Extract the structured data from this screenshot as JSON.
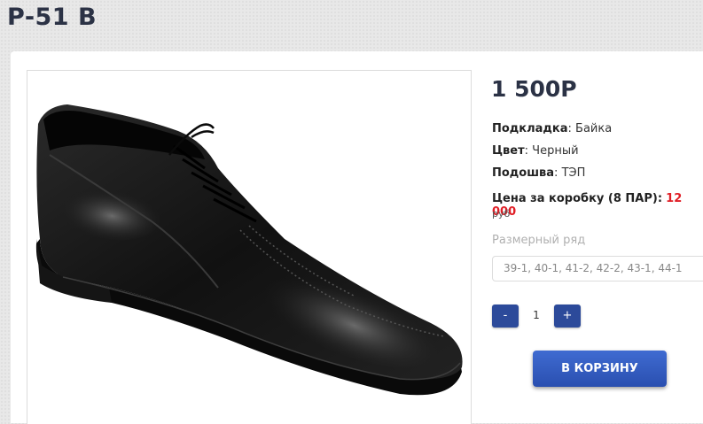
{
  "product": {
    "title": "P-51 B",
    "price": "1 500Р",
    "attributes": [
      {
        "label": "Подкладка",
        "value": "Байка"
      },
      {
        "label": "Цвет",
        "value": "Черный"
      },
      {
        "label": "Подошва",
        "value": "ТЭП"
      }
    ],
    "box_price_label": "Цена за коробку (8 ПАР):",
    "box_price_value": "12 000",
    "box_price_unit": "руб",
    "size_label": "Размерный ряд",
    "size_value": "39-1, 40-1, 41-2, 42-2, 43-1, 44-1",
    "quantity": "1",
    "minus_label": "-",
    "plus_label": "+",
    "cart_button": "В КОРЗИНУ",
    "image_icon": "shoe-photo"
  },
  "colors": {
    "accent": "#2c4a9a",
    "price_red": "#e01d25",
    "title": "#2b3245"
  }
}
